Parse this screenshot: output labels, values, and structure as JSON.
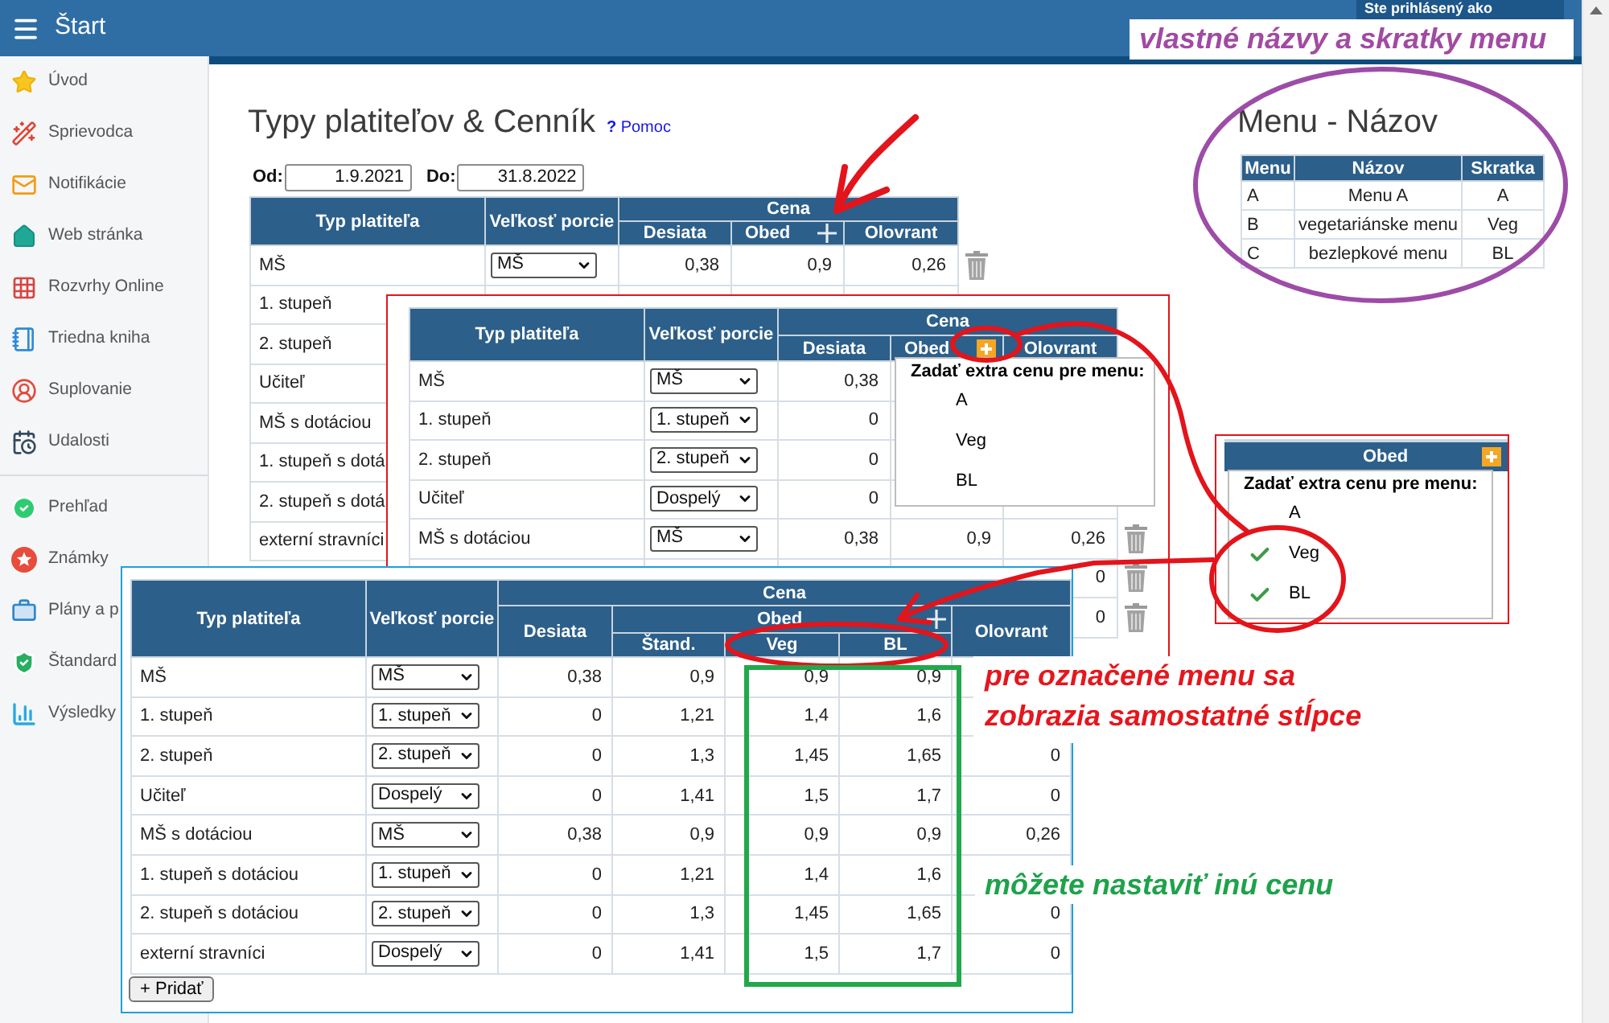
{
  "header": {
    "menu_label": "Štart",
    "login_status": "Ste prihlásený ako"
  },
  "sidebar": {
    "groups": [
      {
        "items": [
          {
            "label": "Úvod"
          },
          {
            "label": "Sprievodca"
          },
          {
            "label": "Notifikácie"
          },
          {
            "label": "Web stránka"
          },
          {
            "label": "Rozvrhy Online"
          },
          {
            "label": "Triedna kniha"
          },
          {
            "label": "Suplovanie"
          },
          {
            "label": "Udalosti"
          }
        ]
      },
      {
        "items": [
          {
            "label": "Prehľad"
          },
          {
            "label": "Známky"
          },
          {
            "label": "Plány a p"
          },
          {
            "label": "Štandard"
          },
          {
            "label": "Výsledky"
          }
        ]
      }
    ]
  },
  "page": {
    "title": "Typy platiteľov & Cenník",
    "help": {
      "icon": "?",
      "label": "Pomoc"
    }
  },
  "period": {
    "from_label": "Od:",
    "from": "1.9.2021",
    "to_label": "Do:",
    "to": "31.8.2022"
  },
  "price_table": {
    "header": {
      "payer": "Typ platiteľa",
      "portion": "Veľkosť porcie",
      "price": "Cena",
      "snack": "Desiata",
      "lunch": "Obed",
      "lunch_add_highlighted": false,
      "afternoon_snack": "Olovrant"
    },
    "rows": [
      {
        "payer": "MŠ",
        "portion": "MŠ",
        "snack": "0,38",
        "lunch": "0,9",
        "afternoon_snack": "0,26"
      },
      {
        "payer": "1. stupeň"
      },
      {
        "payer": "2. stupeň"
      },
      {
        "payer": "Učiteľ"
      },
      {
        "payer": "MŠ s dotáciou"
      },
      {
        "payer": "1. stupeň s dotá"
      },
      {
        "payer": "2. stupeň s dotá"
      },
      {
        "payer": "externí stravníci"
      }
    ]
  },
  "menu_names": {
    "title": "Menu - Názov",
    "columns": [
      "Menu",
      "Názov",
      "Skratka"
    ],
    "rows": [
      {
        "menu": "A",
        "name": "Menu A",
        "short": "A"
      },
      {
        "menu": "B",
        "name": "vegetariánske menu",
        "short": "Veg"
      },
      {
        "menu": "C",
        "name": "bezlepkové menu",
        "short": "BL"
      }
    ]
  },
  "extra_price_view": {
    "table": {
      "header": {
        "payer": "Typ platiteľa",
        "portion": "Veľkosť porcie",
        "price": "Cena",
        "snack": "Desiata",
        "lunch": "Obed",
        "lunch_add_highlighted": true,
        "afternoon_snack": "Olovrant"
      },
      "rows": [
        {
          "payer": "MŠ",
          "portion": "MŠ",
          "snack": "0,38"
        },
        {
          "payer": "1. stupeň",
          "portion": "1. stupeň",
          "snack": "0"
        },
        {
          "payer": "2. stupeň",
          "portion": "2. stupeň",
          "snack": "0"
        },
        {
          "payer": "Učiteľ",
          "portion": "Dospelý",
          "snack": "0"
        },
        {
          "payer": "MŠ s dotáciou",
          "portion": "MŠ",
          "snack": "0,38",
          "lunch": "0,9",
          "afternoon_snack": "0,26"
        },
        {
          "afternoon_snack": "0"
        },
        {
          "afternoon_snack": "0"
        }
      ]
    },
    "popup": {
      "title": "Zadať extra cenu pre menu:",
      "items": [
        {
          "label": "A",
          "checked": false
        },
        {
          "label": "Veg",
          "checked": false
        },
        {
          "label": "BL",
          "checked": false
        }
      ]
    }
  },
  "selected_menus_view": {
    "column": "Obed",
    "add_highlighted": true,
    "popup": {
      "title": "Zadať extra cenu pre menu:",
      "items": [
        {
          "label": "A",
          "checked": false
        },
        {
          "label": "Veg",
          "checked": true
        },
        {
          "label": "BL",
          "checked": true
        }
      ]
    }
  },
  "split_columns_view": {
    "table": {
      "header": {
        "payer": "Typ platiteľa",
        "portion": "Veľkosť porcie",
        "price": "Cena",
        "snack": "Desiata",
        "lunch": "Obed",
        "lunch_add_highlighted": false,
        "lunch_columns": [
          "Štand.",
          "Veg",
          "BL"
        ],
        "afternoon_snack": "Olovrant"
      },
      "rows": [
        {
          "payer": "MŠ",
          "portion": "MŠ",
          "snack": "0,38",
          "lunch": [
            "0,9",
            "0,9",
            "0,9"
          ]
        },
        {
          "payer": "1. stupeň",
          "portion": "1. stupeň",
          "snack": "0",
          "lunch": [
            "1,21",
            "1,4",
            "1,6"
          ]
        },
        {
          "payer": "2. stupeň",
          "portion": "2. stupeň",
          "snack": "0",
          "lunch": [
            "1,3",
            "1,45",
            "1,65"
          ],
          "afternoon_snack": "0"
        },
        {
          "payer": "Učiteľ",
          "portion": "Dospelý",
          "snack": "0",
          "lunch": [
            "1,41",
            "1,5",
            "1,7"
          ],
          "afternoon_snack": "0"
        },
        {
          "payer": "MŠ s dotáciou",
          "portion": "MŠ",
          "snack": "0,38",
          "lunch": [
            "0,9",
            "0,9",
            "0,9"
          ],
          "afternoon_snack": "0,26"
        },
        {
          "payer": "1. stupeň s dotáciou",
          "portion": "1. stupeň",
          "snack": "0",
          "lunch": [
            "1,21",
            "1,4",
            "1,6"
          ]
        },
        {
          "payer": "2. stupeň s dotáciou",
          "portion": "2. stupeň",
          "snack": "0",
          "lunch": [
            "1,3",
            "1,45",
            "1,65"
          ],
          "afternoon_snack": "0"
        },
        {
          "payer": "externí stravníci",
          "portion": "Dospelý",
          "snack": "0",
          "lunch": [
            "1,41",
            "1,5",
            "1,7"
          ],
          "afternoon_snack": "0"
        }
      ]
    },
    "add_button": "+ Pridať"
  },
  "annotations": [
    {
      "text": "vlastné názvy a skratky menu",
      "color": "#a14aa3"
    },
    {
      "text": "pre označené menu sa zobrazia samostatné stĺpce",
      "color": "#e5161d"
    },
    {
      "text": "môžete nastaviť inú cenu",
      "color": "#1ea24a"
    }
  ]
}
